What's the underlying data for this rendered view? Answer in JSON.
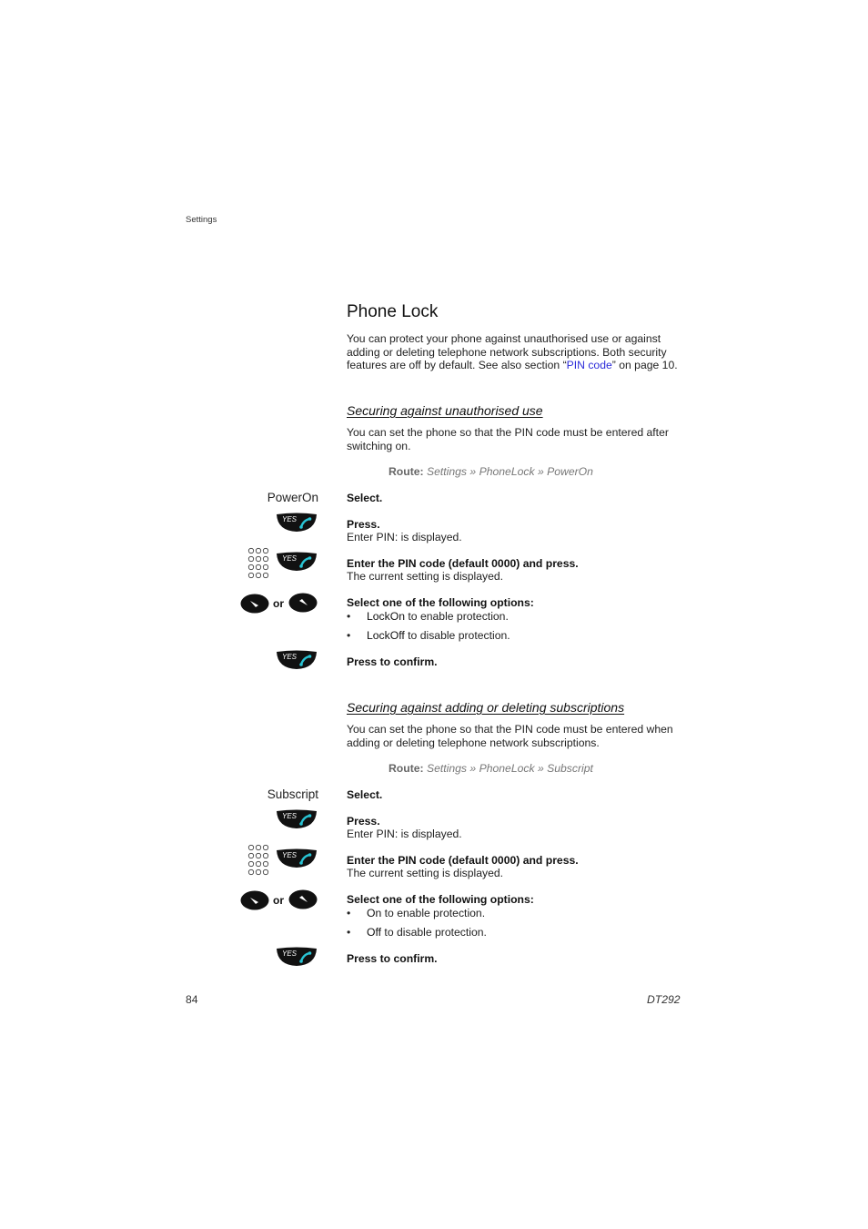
{
  "header": {
    "section": "Settings"
  },
  "title": "Phone Lock",
  "intro": {
    "text_before": "You can protect your phone against unauthorised use or against adding or deleting telephone network subscriptions. Both security features are off by default. See also section “",
    "link": "PIN code",
    "text_after": "” on page 10."
  },
  "sections": [
    {
      "heading": "Securing against unauthorised use",
      "description": "You can set the phone so that the PIN code must be entered after switching on.",
      "route_label": "Route:",
      "route_path": "Settings » PhoneLock » PowerOn",
      "menu_item": "PowerOn",
      "steps": [
        {
          "bold": "Select.",
          "sub": ""
        },
        {
          "bold": "Press.",
          "sub": "Enter PIN: is displayed."
        },
        {
          "bold": "Enter the PIN code (default 0000) and press.",
          "sub": "The current setting is displayed."
        },
        {
          "bold": "Select one of the following options:",
          "sub": ""
        },
        {
          "bold": "Press to confirm.",
          "sub": ""
        }
      ],
      "options": [
        {
          "name": "LockOn",
          "desc": " to enable protection."
        },
        {
          "name": "LockOff",
          "desc": " to disable protection."
        }
      ]
    },
    {
      "heading": "Securing against adding or deleting subscriptions",
      "description": "You can set the phone so that the PIN code must be entered when adding or deleting telephone network subscriptions.",
      "route_label": "Route:",
      "route_path": "Settings » PhoneLock » Subscript",
      "menu_item": "Subscript",
      "steps": [
        {
          "bold": "Select.",
          "sub": ""
        },
        {
          "bold": "Press.",
          "sub": "Enter PIN: is displayed."
        },
        {
          "bold": "Enter the PIN code (default 0000) and press.",
          "sub": "The current setting is displayed."
        },
        {
          "bold": "Select one of the following options:",
          "sub": ""
        },
        {
          "bold": "Press to confirm.",
          "sub": ""
        }
      ],
      "options": [
        {
          "name": "On",
          "desc": " to enable protection."
        },
        {
          "name": "Off",
          "desc": " to disable protection."
        }
      ]
    }
  ],
  "icons": {
    "yes_key_label": "YES",
    "or_label": "or",
    "bullet": "•",
    "accent_color": "#29c4d4"
  },
  "footer": {
    "page_number": "84",
    "model": "DT292"
  }
}
